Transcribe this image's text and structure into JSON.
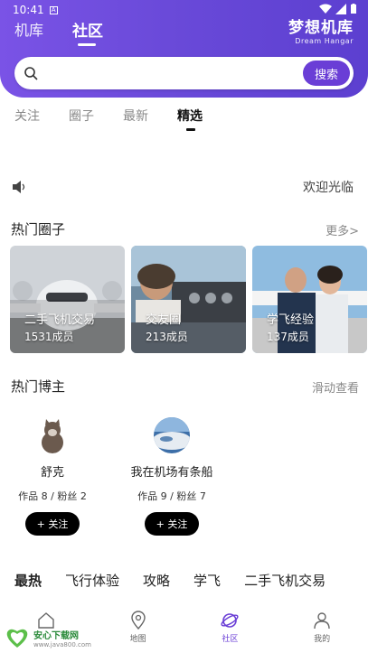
{
  "status": {
    "time": "10:41"
  },
  "header": {
    "tabs": [
      {
        "label": "机库"
      },
      {
        "label": "社区"
      }
    ],
    "brand_zh": "梦想机库",
    "brand_en": "Dream Hangar",
    "accent": "#6a3ed6"
  },
  "search": {
    "value": "",
    "placeholder": "",
    "button_label": "搜索"
  },
  "sub_tabs": [
    {
      "label": "关注"
    },
    {
      "label": "圈子"
    },
    {
      "label": "最新"
    },
    {
      "label": "精选"
    }
  ],
  "notice": {
    "icon": "speaker-icon",
    "text": "欢迎光临"
  },
  "hot_circles": {
    "title": "热门圈子",
    "more_label": "更多>",
    "items": [
      {
        "name": "二手飞机交易",
        "members": "1531成员"
      },
      {
        "name": "交友圈",
        "members": "213成员"
      },
      {
        "name": "学飞经验",
        "members": "137成员"
      }
    ]
  },
  "hot_bloggers": {
    "title": "热门博主",
    "more_label": "滑动查看",
    "items": [
      {
        "name": "舒克",
        "stats": "作品 8  /  粉丝 2",
        "follow_label": "+ 关注"
      },
      {
        "name": "我在机场有条船",
        "stats": "作品 9  /  粉丝 7",
        "follow_label": "+ 关注"
      }
    ]
  },
  "category_tabs": [
    {
      "label": "最热"
    },
    {
      "label": "飞行体验"
    },
    {
      "label": "攻略"
    },
    {
      "label": "学飞"
    },
    {
      "label": "二手飞机交易"
    }
  ],
  "bottom_nav": [
    {
      "label": "",
      "icon": "home-icon"
    },
    {
      "label": "地图",
      "icon": "map-pin-icon"
    },
    {
      "label": "社区",
      "icon": "planet-icon"
    },
    {
      "label": "我的",
      "icon": "user-icon"
    }
  ],
  "watermark": {
    "title": "安心下载网",
    "url": "www.java800.com",
    "logo_text": "安心下载"
  }
}
